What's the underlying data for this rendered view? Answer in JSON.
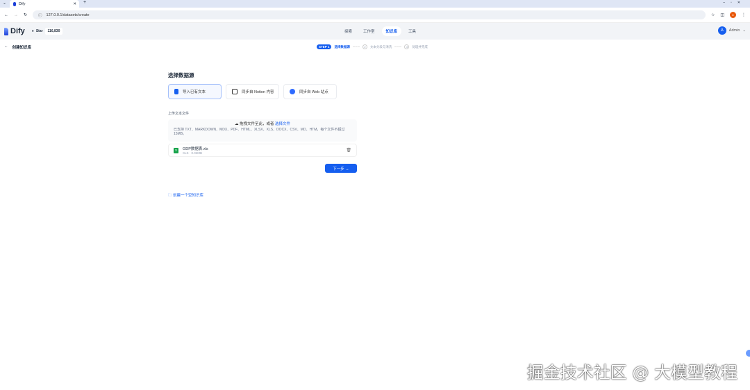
{
  "browser": {
    "tab_title": "Dify",
    "url": "127.0.0.1/datasets/create"
  },
  "header": {
    "logo": "Dify",
    "star_label": "Star",
    "star_count": "116,830",
    "nav": [
      "探索",
      "工作室",
      "知识库",
      "工具"
    ],
    "user_initial": "A",
    "user_name": "Admin"
  },
  "subheader": {
    "back_label": "创建知识库",
    "step_badge": "STEP 1",
    "step1": "选择数据源",
    "step2_num": "2",
    "step2": "文本分段与清洗",
    "step3_num": "3",
    "step3": "处理并完成"
  },
  "main": {
    "title": "选择数据源",
    "sources": [
      "导入已有文本",
      "同步自 Notion 内容",
      "同步自 Web 站点"
    ],
    "upload_label": "上传文本文件",
    "drop_text": "拖拽文件至此，或者",
    "drop_link": "选择文件",
    "drop_hint": "已支持 TXT、MARKDOWN、MDX、PDF、HTML、XLSX、XLS、DOCX、CSV、MD、HTM，每个文件不超过 15MB。",
    "file_name": "GDP数据表.xls",
    "file_meta": "XLS · 0.02MB",
    "next": "下一步 →",
    "empty_link": "创建一个空知识库"
  },
  "watermark": "掘金技术社区 @ 大模型教程"
}
